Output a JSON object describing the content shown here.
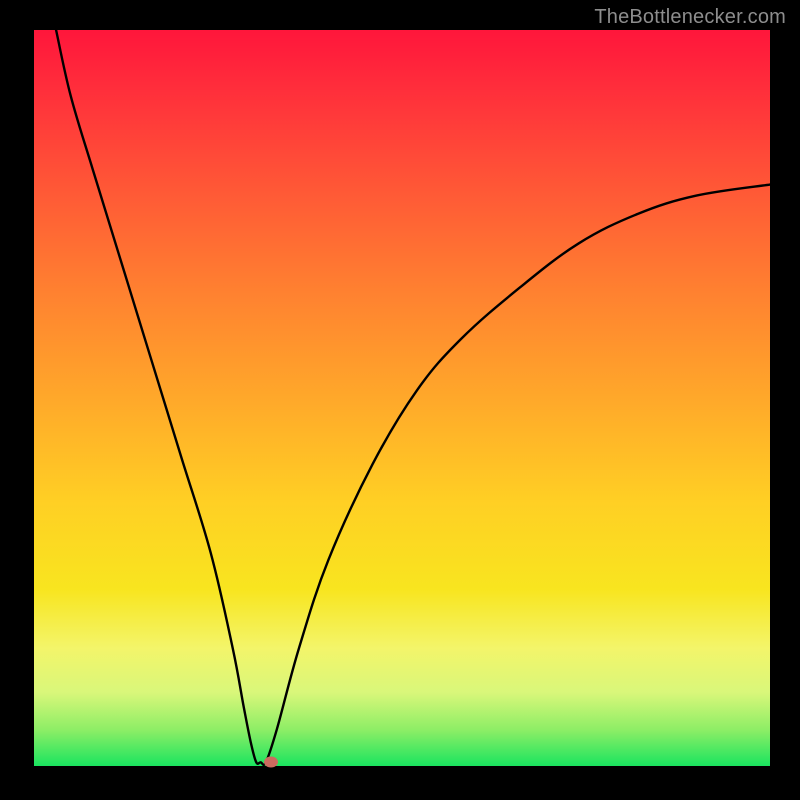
{
  "watermark": "TheBottlenecker.com",
  "chart_data": {
    "type": "line",
    "title": "",
    "xlabel": "",
    "ylabel": "",
    "xlim": [
      0,
      100
    ],
    "ylim": [
      0,
      100
    ],
    "series": [
      {
        "name": "bottleneck-curve",
        "x": [
          3,
          5,
          8,
          12,
          16,
          20,
          24,
          27,
          28.5,
          29.5,
          30.2,
          30.8,
          31.5,
          33,
          36,
          40,
          46,
          52,
          58,
          66,
          74,
          82,
          90,
          100
        ],
        "y": [
          100,
          91,
          81,
          68,
          55,
          42,
          29,
          16,
          8,
          3,
          0.5,
          0.5,
          0.5,
          5,
          16,
          28,
          41,
          51,
          58,
          65,
          71,
          75,
          77.5,
          79
        ]
      }
    ],
    "marker": {
      "x": 32.2,
      "y": 0.5,
      "color": "#cc6a5f"
    },
    "background_gradient": {
      "top": "#ff163b",
      "bottom": "#1ae45f"
    }
  }
}
